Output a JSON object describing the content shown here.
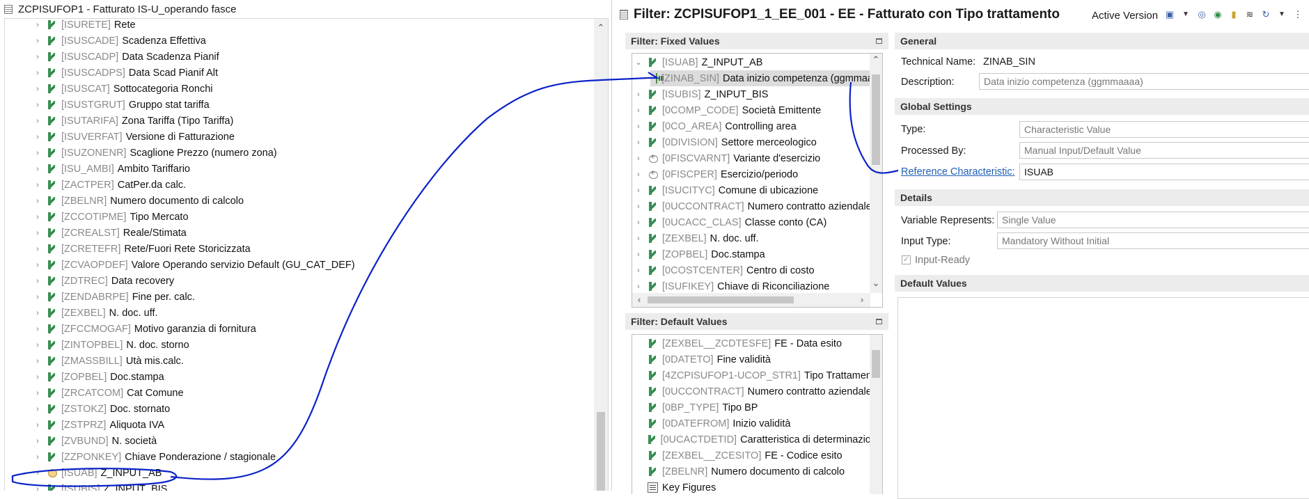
{
  "left_pane": {
    "title": "ZCPISUFOP1 - Fatturato IS-U_operando fasce",
    "tree_items": [
      {
        "code": "[ISURETE]",
        "label": "Rete",
        "icon": "characteristic-icon"
      },
      {
        "code": "[ISUSCADE]",
        "label": "Scadenza  Effettiva",
        "icon": "characteristic-icon"
      },
      {
        "code": "[ISUSCADP]",
        "label": "Data Scadenza Pianif",
        "icon": "characteristic-icon"
      },
      {
        "code": "[ISUSCADPS]",
        "label": "Data Scad Pianif Alt",
        "icon": "characteristic-icon"
      },
      {
        "code": "[ISUSCAT]",
        "label": "Sottocategoria Ronchi",
        "icon": "characteristic-icon"
      },
      {
        "code": "[ISUSTGRUT]",
        "label": "Gruppo stat tariffa",
        "icon": "characteristic-icon"
      },
      {
        "code": "[ISUTARIFA]",
        "label": "Zona Tariffa (Tipo Tariffa)",
        "icon": "characteristic-icon"
      },
      {
        "code": "[ISUVERFAT]",
        "label": "Versione di Fatturazione",
        "icon": "characteristic-icon"
      },
      {
        "code": "[ISUZONENR]",
        "label": "Scaglione Prezzo (numero zona)",
        "icon": "characteristic-icon"
      },
      {
        "code": "[ISU_AMBI]",
        "label": "Ambito Tariffario",
        "icon": "characteristic-icon"
      },
      {
        "code": "[ZACTPER]",
        "label": "CatPer.da calc.",
        "icon": "characteristic-icon"
      },
      {
        "code": "[ZBELNR]",
        "label": "Numero documento di calcolo",
        "icon": "characteristic-icon"
      },
      {
        "code": "[ZCCOTIPME]",
        "label": "Tipo Mercato",
        "icon": "characteristic-icon"
      },
      {
        "code": "[ZCREALST]",
        "label": "Reale/Stimata",
        "icon": "characteristic-icon"
      },
      {
        "code": "[ZCRETEFR]",
        "label": "Rete/Fuori Rete Storicizzata",
        "icon": "characteristic-icon"
      },
      {
        "code": "[ZCVAOPDEF]",
        "label": "Valore Operando servizio Default (GU_CAT_DEF)",
        "icon": "characteristic-icon"
      },
      {
        "code": "[ZDTREC]",
        "label": "Data recovery",
        "icon": "characteristic-icon"
      },
      {
        "code": "[ZENDABRPE]",
        "label": "Fine per. calc.",
        "icon": "characteristic-icon"
      },
      {
        "code": "[ZEXBEL]",
        "label": "N. doc. uff.",
        "icon": "characteristic-icon"
      },
      {
        "code": "[ZFCCMOGAF]",
        "label": "Motivo garanzia di fornitura",
        "icon": "characteristic-icon"
      },
      {
        "code": "[ZINTOPBEL]",
        "label": "N. doc. storno",
        "icon": "characteristic-icon"
      },
      {
        "code": "[ZMASSBILL]",
        "label": "Utà mis.calc.",
        "icon": "characteristic-icon"
      },
      {
        "code": "[ZOPBEL]",
        "label": "Doc.stampa",
        "icon": "characteristic-icon"
      },
      {
        "code": "[ZRCATCOM]",
        "label": "Cat Comune",
        "icon": "characteristic-icon"
      },
      {
        "code": "[ZSTOKZ]",
        "label": "Doc. stornato",
        "icon": "characteristic-icon"
      },
      {
        "code": "[ZSTPRZ]",
        "label": "Aliquota IVA",
        "icon": "characteristic-icon"
      },
      {
        "code": "[ZVBUND]",
        "label": "N. società",
        "icon": "characteristic-icon"
      },
      {
        "code": "[ZZPONKEY]",
        "label": "Chiave Ponderazione / stagionale",
        "icon": "characteristic-icon"
      },
      {
        "code": "[ISUAB]",
        "label": "Z_INPUT_AB",
        "icon": "context-icon"
      },
      {
        "code": "[ISUBIS]",
        "label": "Z_INPUT_BIS",
        "icon": "characteristic-icon"
      }
    ]
  },
  "right_pane": {
    "title": "Filter: ZCPISUFOP1_1_EE_001 - EE - Fatturato con Tipo trattamento",
    "active_version": "Active Version",
    "fixed_values": {
      "header": "Filter: Fixed Values",
      "items": [
        {
          "code": "[ISUAB]",
          "label": "Z_INPUT_AB",
          "icon": "characteristic-icon",
          "expanded": true,
          "level": 0
        },
        {
          "code": "[ZINAB_SIN]",
          "label": "Data inizio competenza (ggmmaaaa)",
          "icon": "variable-icon",
          "level": 1,
          "selected": true
        },
        {
          "code": "[ISUBIS]",
          "label": "Z_INPUT_BIS",
          "icon": "characteristic-icon",
          "level": 0
        },
        {
          "code": "[0COMP_CODE]",
          "label": "Società Emittente",
          "icon": "characteristic-icon",
          "level": 0
        },
        {
          "code": "[0CO_AREA]",
          "label": "Controlling area",
          "icon": "characteristic-icon",
          "level": 0
        },
        {
          "code": "[0DIVISION]",
          "label": "Settore merceologico",
          "icon": "characteristic-icon",
          "level": 0
        },
        {
          "code": "[0FISCVARNT]",
          "label": "Variante d'esercizio",
          "icon": "reference-icon",
          "level": 0
        },
        {
          "code": "[0FISCPER]",
          "label": "Esercizio/periodo",
          "icon": "reference-icon",
          "level": 0
        },
        {
          "code": "[ISUCITYC]",
          "label": "Comune di ubicazione",
          "icon": "characteristic-icon",
          "level": 0
        },
        {
          "code": "[0UCCONTRACT]",
          "label": "Numero contratto aziendale",
          "icon": "characteristic-icon",
          "level": 0
        },
        {
          "code": "[0UCACC_CLAS]",
          "label": "Classe conto (CA)",
          "icon": "characteristic-icon",
          "level": 0
        },
        {
          "code": "[ZEXBEL]",
          "label": "N. doc. uff.",
          "icon": "characteristic-icon",
          "level": 0
        },
        {
          "code": "[ZOPBEL]",
          "label": "Doc.stampa",
          "icon": "characteristic-icon",
          "level": 0
        },
        {
          "code": "[0COSTCENTER]",
          "label": "Centro di costo",
          "icon": "characteristic-icon",
          "level": 0
        },
        {
          "code": "[ISUFIKEY]",
          "label": "Chiave di Riconciliazione",
          "icon": "characteristic-icon",
          "level": 0
        }
      ]
    },
    "default_values": {
      "header": "Filter: Default Values",
      "items": [
        {
          "code": "[ZEXBEL__ZCDTESFE]",
          "label": "FE - Data esito",
          "icon": "characteristic-icon"
        },
        {
          "code": "[0DATETO]",
          "label": "Fine validità",
          "icon": "characteristic-icon"
        },
        {
          "code": "[4ZCPISUFOP1-UCOP_STR1]",
          "label": "Tipo Trattamento",
          "icon": "characteristic-icon"
        },
        {
          "code": "[0UCCONTRACT]",
          "label": "Numero contratto aziendale",
          "icon": "characteristic-icon"
        },
        {
          "code": "[0BP_TYPE]",
          "label": "Tipo BP",
          "icon": "characteristic-icon"
        },
        {
          "code": "[0DATEFROM]",
          "label": "Inizio validità",
          "icon": "characteristic-icon"
        },
        {
          "code": "[0UCACTDETID]",
          "label": "Caratteristica di determinazione",
          "icon": "characteristic-icon"
        },
        {
          "code": "[ZEXBEL__ZCESITO]",
          "label": "FE - Codice esito",
          "icon": "characteristic-icon"
        },
        {
          "code": "[ZBELNR]",
          "label": "Numero documento di calcolo",
          "icon": "characteristic-icon"
        },
        {
          "code": "",
          "label": "Key Figures",
          "icon": "key-figures-icon"
        }
      ]
    },
    "properties": {
      "general_header": "General",
      "technical_name_label": "Technical Name:",
      "technical_name_value": "ZINAB_SIN",
      "description_label": "Description:",
      "description_value": "Data inizio competenza (ggmmaaaa)",
      "global_header": "Global Settings",
      "type_label": "Type:",
      "type_value": "Characteristic Value",
      "processed_label": "Processed By:",
      "processed_value": "Manual Input/Default Value",
      "ref_label": "Reference Characteristic:",
      "ref_value": "ISUAB",
      "details_header": "Details",
      "var_rep_label": "Variable Represents:",
      "var_rep_value": "Single Value",
      "input_type_label": "Input Type:",
      "input_type_value": "Mandatory Without Initial",
      "input_ready_label": "Input-Ready",
      "input_ready_checked": true,
      "default_header": "Default Values"
    }
  },
  "colors": {
    "annotation": "#0a22c8",
    "link": "#1f5fb4",
    "icon_green": "#2f8a4a"
  }
}
